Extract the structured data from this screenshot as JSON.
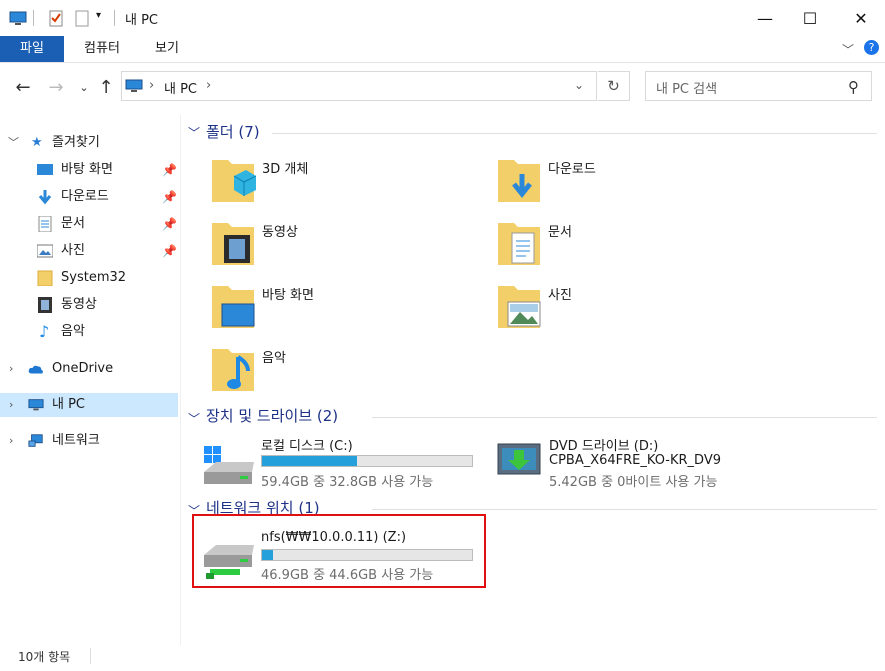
{
  "window": {
    "title": "내 PC"
  },
  "ribbon": {
    "tabs": [
      "파일",
      "컴퓨터",
      "보기"
    ]
  },
  "address": {
    "path_label": "내 PC"
  },
  "search": {
    "placeholder": "내 PC 검색"
  },
  "nav": {
    "quick_access": "즐겨찾기",
    "quick_items": [
      {
        "label": "바탕 화면",
        "icon": "desktop-icon",
        "pinned": true
      },
      {
        "label": "다운로드",
        "icon": "download-icon",
        "pinned": true
      },
      {
        "label": "문서",
        "icon": "document-icon",
        "pinned": true
      },
      {
        "label": "사진",
        "icon": "picture-icon",
        "pinned": true
      },
      {
        "label": "System32",
        "icon": "folder-icon",
        "pinned": false
      },
      {
        "label": "동영상",
        "icon": "video-icon",
        "pinned": false
      },
      {
        "label": "음악",
        "icon": "music-icon",
        "pinned": false
      }
    ],
    "onedrive": "OneDrive",
    "this_pc": "내 PC",
    "network": "네트워크"
  },
  "groups": {
    "folders": "폴더 (7)",
    "devices": "장치 및 드라이브 (2)",
    "network": "네트워크 위치 (1)"
  },
  "folders": [
    {
      "name": "3D 개체",
      "icon": "3d-objects-icon"
    },
    {
      "name": "다운로드",
      "icon": "download-folder-icon"
    },
    {
      "name": "동영상",
      "icon": "video-folder-icon"
    },
    {
      "name": "문서",
      "icon": "document-folder-icon"
    },
    {
      "name": "바탕 화면",
      "icon": "desktop-folder-icon"
    },
    {
      "name": "사진",
      "icon": "picture-folder-icon"
    },
    {
      "name": "음악",
      "icon": "music-folder-icon"
    }
  ],
  "drives": [
    {
      "name": "로컬 디스크 (C:)",
      "space": "59.4GB 중 32.8GB 사용 가능",
      "used_fraction": 0.45
    },
    {
      "name": "DVD 드라이브 (D:)",
      "label": "CPBA_X64FRE_KO-KR_DV9",
      "space": "5.42GB 중 0바이트 사용 가능"
    }
  ],
  "network_drive": {
    "name": "nfs(₩₩10.0.0.11) (Z:)",
    "space": "46.9GB 중 44.6GB 사용 가능",
    "used_fraction": 0.05
  },
  "status": {
    "count": "10개 항목"
  },
  "colors": {
    "accent": "#1a5fb4",
    "bar_fill": "#26a0da",
    "group_header": "#1e3287",
    "highlight": "#e01010",
    "selected": "#cce8ff"
  }
}
